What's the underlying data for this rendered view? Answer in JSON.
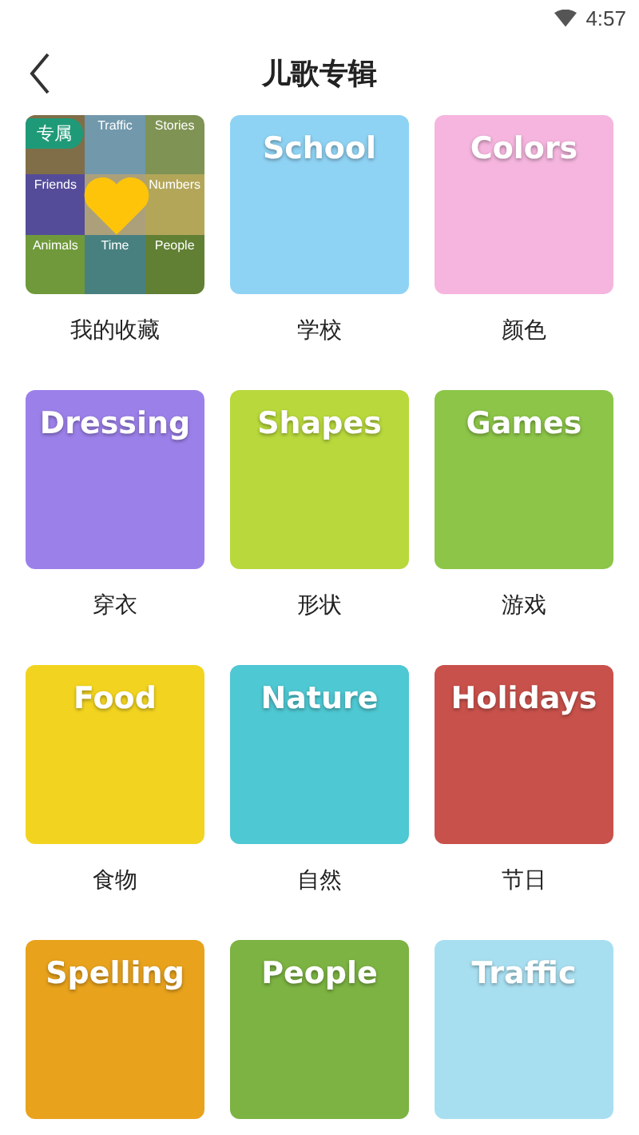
{
  "status_bar": {
    "time": "4:57"
  },
  "header": {
    "title": "儿歌专辑"
  },
  "albums": [
    {
      "kind": "collage",
      "label": "我的收藏",
      "badge": "专属",
      "cells": [
        {
          "text": "",
          "color": "#806e48"
        },
        {
          "text": "Traffic",
          "color": "#7298ac"
        },
        {
          "text": "Stories",
          "color": "#7f9354"
        },
        {
          "text": "Friends",
          "color": "#544c99"
        },
        {
          "text": "",
          "color": "#aca07b"
        },
        {
          "text": "Numbers",
          "color": "#b3a659"
        },
        {
          "text": "Animals",
          "color": "#70993b"
        },
        {
          "text": "Time",
          "color": "#488080"
        },
        {
          "text": "People",
          "color": "#618033"
        }
      ]
    },
    {
      "kind": "cover",
      "label": "学校",
      "cover_title": "School",
      "color": "#8fd3f4"
    },
    {
      "kind": "cover",
      "label": "颜色",
      "cover_title": "Colors",
      "color": "#f5b5de"
    },
    {
      "kind": "cover",
      "label": "穿衣",
      "cover_title": "Dressing",
      "color": "#9c80ea"
    },
    {
      "kind": "cover",
      "label": "形状",
      "cover_title": "Shapes",
      "color": "#b8d83c"
    },
    {
      "kind": "cover",
      "label": "游戏",
      "cover_title": "Games",
      "color": "#8cc548"
    },
    {
      "kind": "cover",
      "label": "食物",
      "cover_title": "Food",
      "color": "#f2d420"
    },
    {
      "kind": "cover",
      "label": "自然",
      "cover_title": "Nature",
      "color": "#4ec8d2"
    },
    {
      "kind": "cover",
      "label": "节日",
      "cover_title": "Holidays",
      "color": "#c9514b"
    },
    {
      "kind": "cover",
      "cover_title": "Spelling",
      "color": "#e8a21c"
    },
    {
      "kind": "cover",
      "cover_title": "People",
      "color": "#7cb342"
    },
    {
      "kind": "cover",
      "cover_title": "Traffic",
      "color": "#a8dff0"
    }
  ]
}
